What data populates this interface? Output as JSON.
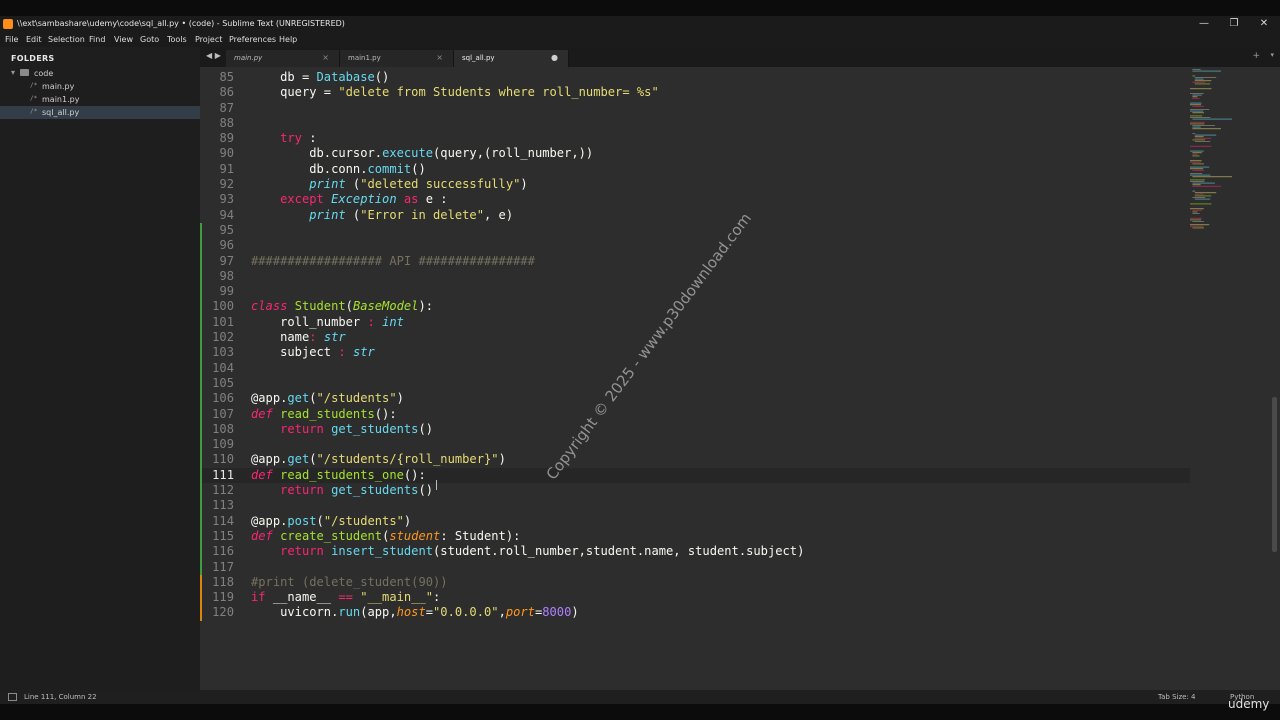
{
  "window": {
    "title": "\\\\ext\\sambashare\\udemy\\code\\sql_all.py • (code) - Sublime Text (UNREGISTERED)",
    "buttons": {
      "minimize": "—",
      "maximize": "❐",
      "close": "✕"
    }
  },
  "menu": [
    "File",
    "Edit",
    "Selection",
    "Find",
    "View",
    "Goto",
    "Tools",
    "Project",
    "Preferences",
    "Help"
  ],
  "sidebar": {
    "header": "FOLDERS",
    "folder": {
      "arrow": "▾",
      "name": "code"
    },
    "files": [
      {
        "icon": "/*",
        "name": "main.py",
        "selected": false
      },
      {
        "icon": "/*",
        "name": "main1.py",
        "selected": false
      },
      {
        "icon": "/*",
        "name": "sql_all.py",
        "selected": true
      }
    ]
  },
  "tabs": [
    {
      "label": "main.py",
      "close": "×"
    },
    {
      "label": "main1.py",
      "close": "×"
    },
    {
      "label": "sql_all.py",
      "close": "●"
    }
  ],
  "tabbar": {
    "nav": "◀ ▶",
    "plus": "+",
    "dropdown": "▾"
  },
  "editor": {
    "current_line": 111,
    "lines": [
      {
        "n": 85,
        "html": "    db = <span class=\"fn\">Database</span>()"
      },
      {
        "n": 86,
        "html": "    query = <span class=\"str\">\"delete from Students where roll_number= %s\"</span>"
      },
      {
        "n": 87,
        "html": ""
      },
      {
        "n": 88,
        "html": ""
      },
      {
        "n": 89,
        "html": "    <span class=\"kw\">try</span> :"
      },
      {
        "n": 90,
        "html": "        db.cursor.<span class=\"fn\">execute</span>(query,(roll_number,))"
      },
      {
        "n": 91,
        "html": "        db.conn.<span class=\"fn\">commit</span>()"
      },
      {
        "n": 92,
        "html": "        <span class=\"fn ital\">print</span> (<span class=\"str\">\"deleted successfully\"</span>)"
      },
      {
        "n": 93,
        "html": "    <span class=\"kw\">except</span> <span class=\"ty\">Exception</span> <span class=\"kw\">as</span> e :"
      },
      {
        "n": 94,
        "html": "        <span class=\"fn ital\">print</span> (<span class=\"str\">\"Error in delete\"</span>, e)"
      },
      {
        "n": 95,
        "html": ""
      },
      {
        "n": 96,
        "html": ""
      },
      {
        "n": 97,
        "html": "<span class=\"cmt\">################## API ################</span>"
      },
      {
        "n": 98,
        "html": ""
      },
      {
        "n": 99,
        "html": ""
      },
      {
        "n": 100,
        "html": "<span class=\"kw ital\">class</span> <span class=\"cls\">Student</span>(<span class=\"cls ital\">BaseModel</span>):"
      },
      {
        "n": 101,
        "html": "    roll_number <span class=\"kw\">:</span> <span class=\"ty\">int</span>"
      },
      {
        "n": 102,
        "html": "    name<span class=\"kw\">:</span> <span class=\"ty\">str</span>"
      },
      {
        "n": 103,
        "html": "    subject <span class=\"kw\">:</span> <span class=\"ty\">str</span>"
      },
      {
        "n": 104,
        "html": ""
      },
      {
        "n": 105,
        "html": ""
      },
      {
        "n": 106,
        "html": "@app.<span class=\"fn\">get</span>(<span class=\"str\">\"/students\"</span>)"
      },
      {
        "n": 107,
        "html": "<span class=\"kw ital\">def</span> <span class=\"cls\">read_students</span>():"
      },
      {
        "n": 108,
        "html": "    <span class=\"kw\">return</span> <span class=\"fn\">get_students</span>()"
      },
      {
        "n": 109,
        "html": ""
      },
      {
        "n": 110,
        "html": "@app.<span class=\"fn\">get</span>(<span class=\"str\">\"/students/{roll_number}\"</span>)"
      },
      {
        "n": 111,
        "html": "<span class=\"kw ital\">def</span> <span class=\"cls\">read_students_one</span>():"
      },
      {
        "n": 112,
        "html": "    <span class=\"kw\">return</span> <span class=\"fn\">get_students</span>()"
      },
      {
        "n": 113,
        "html": ""
      },
      {
        "n": 114,
        "html": "@app.<span class=\"fn\">post</span>(<span class=\"str\">\"/students\"</span>)"
      },
      {
        "n": 115,
        "html": "<span class=\"kw ital\">def</span> <span class=\"cls\">create_student</span>(<span class=\"arg\">student</span>: Student):"
      },
      {
        "n": 116,
        "html": "    <span class=\"kw\">return</span> <span class=\"fn\">insert_student</span>(student.roll_number,student.name, student.subject)"
      },
      {
        "n": 117,
        "html": ""
      },
      {
        "n": 118,
        "html": "<span class=\"cmt\">#print (delete_student(90))</span>"
      },
      {
        "n": 119,
        "html": "<span class=\"kw\">if</span> __name__ <span class=\"kw\">==</span> <span class=\"str\">\"__main__\"</span>:"
      },
      {
        "n": 120,
        "html": "    uvicorn.<span class=\"fn\">run</span>(app,<span class=\"arg\">host</span>=<span class=\"str\">\"0.0.0.0\"</span>,<span class=\"arg\">port</span>=<span class=\"num\">8000</span>)"
      }
    ],
    "gutter_marks": {
      "added": [
        95,
        96,
        97,
        98,
        99,
        100,
        101,
        102,
        103,
        104,
        105,
        106,
        107,
        108,
        109,
        110,
        111,
        112,
        113,
        114,
        115,
        116,
        117
      ],
      "modified": [
        118,
        119,
        120
      ],
      "colors": {
        "added": "#3e9d3e",
        "modified": "#d9860b"
      }
    }
  },
  "watermark": "Copyright © 2025 - www.p30download.com",
  "statusbar": {
    "position": "Line 111, Column 22",
    "tab_size": "Tab Size: 4",
    "syntax": "Python"
  },
  "brand": "udemy",
  "colors": {
    "editor_bg": "#2d2d2d",
    "sidebar_bg": "#1e1e1e",
    "selection_bg": "#333d47",
    "keyword": "#f92672",
    "function": "#66d9ef",
    "string": "#e6db74",
    "class": "#a6e22e"
  }
}
